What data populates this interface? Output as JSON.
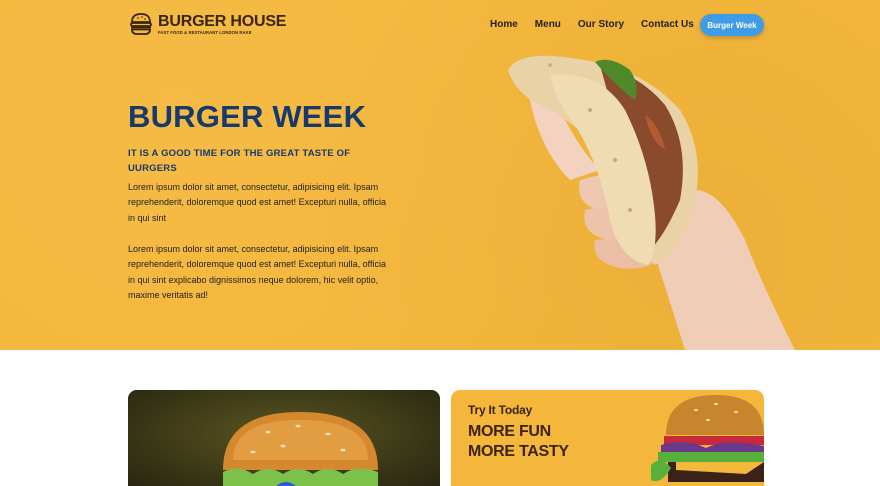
{
  "brand": {
    "name": "BURGER HOUSE",
    "tagline": "FAST FOOD & RESTAURANT LONDON RAKE"
  },
  "nav": {
    "items": [
      "Home",
      "Menu",
      "Our Story",
      "Contact Us"
    ],
    "cta_label": "Burger Week"
  },
  "hero": {
    "title": "BURGER WEEK",
    "subtitle": "IT IS A GOOD TIME FOR THE GREAT TASTE OF UURGERS",
    "paragraph_1": "Lorem ipsum dolor sit amet, consectetur, adipisicing elit. Ipsam reprehenderit, doloremque quod est amet! Excepturi nulla, officia in qui sint",
    "paragraph_2": "Lorem ipsum dolor sit amet, consectetur, adipisicing elit. Ipsam reprehenderit, doloremque quod est amet! Excepturi nulla, officia in qui sint explicabo dignissimos neque dolorem, hic velit optio, maxime veritatis ad!"
  },
  "promo": {
    "eyebrow": "Try It Today",
    "headline": "MORE FUN MORE TASTY"
  },
  "colors": {
    "hero_bg": "#f5b73b",
    "title": "#163a6b",
    "cta": "#3f9ce6",
    "brand_brown": "#3b2410"
  },
  "icons": [
    "burger-logo-icon"
  ]
}
